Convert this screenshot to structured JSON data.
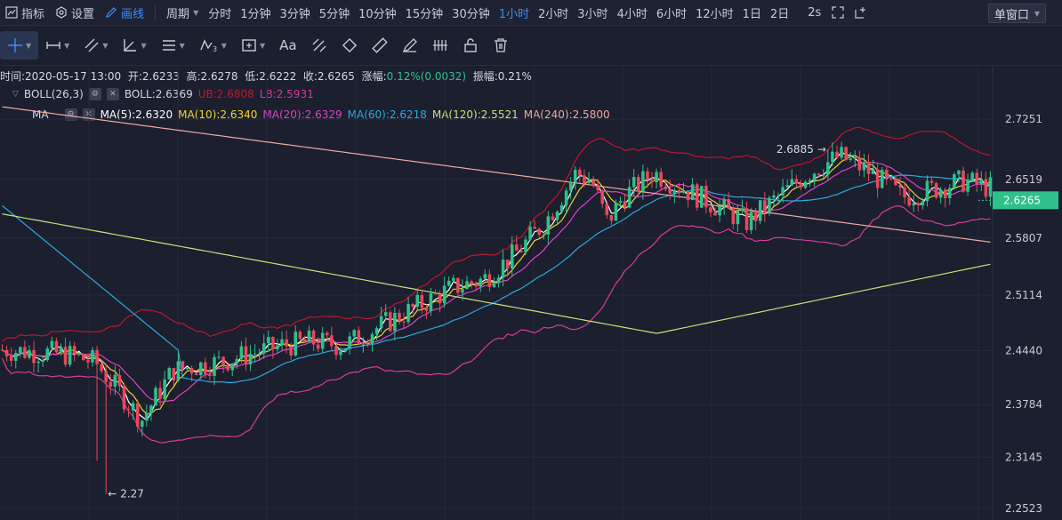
{
  "topbar": {
    "indicators": "指标",
    "settings": "设置",
    "draw": "画线",
    "period_label": "周期",
    "periods": [
      "分时",
      "1分钟",
      "3分钟",
      "5分钟",
      "10分钟",
      "15分钟",
      "30分钟",
      "1小时",
      "2小时",
      "3小时",
      "4小时",
      "6小时",
      "12小时",
      "1日",
      "2日"
    ],
    "active_period": "1小时",
    "refresh": "2s",
    "window_mode": "单窗口"
  },
  "info": {
    "time": "时间:2020-05-17 13:00",
    "open": "开:2.6233",
    "high": "高:2.6278",
    "low": "低:2.6222",
    "close": "收:2.6265",
    "change_label": "涨幅:",
    "change_value": "0.12%(0.0032)",
    "amplitude": "振幅:0.21%"
  },
  "boll": {
    "name": "BOLL(26,3)",
    "mid": "BOLL:2.6369",
    "ub": "UB:2.6808",
    "lb": "LB:2.5931",
    "colors": {
      "mid": "#ffffff",
      "ub": "#c0192b",
      "lb": "#d63c9c"
    }
  },
  "ma": {
    "name": "MA",
    "items": [
      {
        "label": "MA(5):2.6320",
        "color": "#ffffff"
      },
      {
        "label": "MA(10):2.6340",
        "color": "#f0d232"
      },
      {
        "label": "MA(20):2.6329",
        "color": "#e040c8"
      },
      {
        "label": "MA(60):2.6218",
        "color": "#2ea7e0"
      },
      {
        "label": "MA(120):2.5521",
        "color": "#c8e07a"
      },
      {
        "label": "MA(240):2.5800",
        "color": "#f0a8a0"
      }
    ]
  },
  "chart_data": {
    "type": "candlestick",
    "y_ticks": [
      "2.7251",
      "2.6519",
      "2.5807",
      "2.5114",
      "2.4440",
      "2.3784",
      "2.3145",
      "2.2523"
    ],
    "last_price": "2.6265",
    "high_annotation": "2.6885",
    "low_annotation": "2.27",
    "colors": {
      "up": "#2fc08b",
      "down": "#e8495a",
      "last_price_bg": "#2fc08b"
    }
  }
}
